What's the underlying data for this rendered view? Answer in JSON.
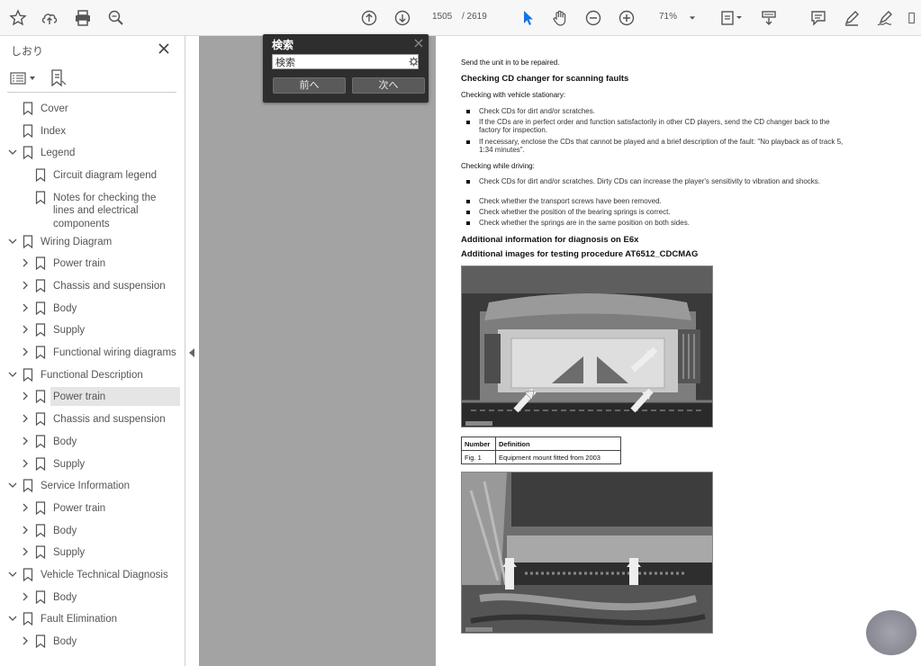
{
  "toolbar": {
    "page_current": "1505",
    "page_total": "/ 2619",
    "zoom": "71%"
  },
  "sidebar": {
    "title": "しおり",
    "items": [
      {
        "label": "Cover",
        "level": 0,
        "expander": "none"
      },
      {
        "label": "Index",
        "level": 0,
        "expander": "none"
      },
      {
        "label": "Legend",
        "level": 0,
        "expander": "expanded"
      },
      {
        "label": "Circuit diagram legend",
        "level": 1,
        "expander": "none"
      },
      {
        "label": "Notes for checking the lines and electrical components",
        "level": 1,
        "expander": "none"
      },
      {
        "label": "Wiring Diagram",
        "level": 0,
        "expander": "expanded"
      },
      {
        "label": "Power train",
        "level": 1,
        "expander": "collapsed"
      },
      {
        "label": "Chassis and suspension",
        "level": 1,
        "expander": "collapsed"
      },
      {
        "label": "Body",
        "level": 1,
        "expander": "collapsed"
      },
      {
        "label": "Supply",
        "level": 1,
        "expander": "collapsed"
      },
      {
        "label": "Functional wiring diagrams",
        "level": 1,
        "expander": "collapsed"
      },
      {
        "label": "Functional Description",
        "level": 0,
        "expander": "expanded"
      },
      {
        "label": "Power train",
        "level": 1,
        "expander": "collapsed",
        "selected": true
      },
      {
        "label": "Chassis and suspension",
        "level": 1,
        "expander": "collapsed"
      },
      {
        "label": "Body",
        "level": 1,
        "expander": "collapsed"
      },
      {
        "label": "Supply",
        "level": 1,
        "expander": "collapsed"
      },
      {
        "label": "Service Information",
        "level": 0,
        "expander": "expanded"
      },
      {
        "label": "Power train",
        "level": 1,
        "expander": "collapsed"
      },
      {
        "label": "Body",
        "level": 1,
        "expander": "collapsed"
      },
      {
        "label": "Supply",
        "level": 1,
        "expander": "collapsed"
      },
      {
        "label": "Vehicle Technical Diagnosis",
        "level": 0,
        "expander": "expanded"
      },
      {
        "label": "Body",
        "level": 1,
        "expander": "collapsed"
      },
      {
        "label": "Fault Elimination",
        "level": 0,
        "expander": "expanded"
      },
      {
        "label": "Body",
        "level": 1,
        "expander": "collapsed"
      }
    ]
  },
  "search": {
    "title": "検索",
    "value": "検索",
    "prev_label": "前へ",
    "next_label": "次へ"
  },
  "document": {
    "intro": "Send the unit in to be repaired.",
    "heading1": "Checking CD changer for scanning faults",
    "sub1": "Checking with vehicle stationary:",
    "list1": [
      "Check CDs for dirt and/or scratches.",
      "If the CDs are in perfect order and function satisfactorily in other CD players, send the CD changer back to the factory for inspection.",
      "If necessary, enclose the CDs that cannot be played and a brief description of the fault: \"No playback as of track 5, 1:34 minutes\"."
    ],
    "sub2": "Checking while driving:",
    "list2": [
      "Check CDs for dirt and/or scratches. Dirty CDs can increase the player's sensitivity to vibration and shocks.",
      "Check whether the transport screws have been removed.",
      "Check whether the position of the bearing springs is correct.",
      "Check whether the springs are in the same position on both sides."
    ],
    "heading2": "Additional information for diagnosis on E6x",
    "heading3": "Additional images for testing procedure AT6512_CDCMAG",
    "table": {
      "headers": [
        "Number",
        "Definition"
      ],
      "rows": [
        [
          "Fig. 1",
          "Equipment mount fitted from 2003"
        ]
      ]
    }
  },
  "colors": {
    "toolbar_bg": "#f7f7f7",
    "canvas_gray": "#a3a3a3",
    "selected_bg": "#e5e5e5",
    "cursor_blue": "#1473e6"
  }
}
